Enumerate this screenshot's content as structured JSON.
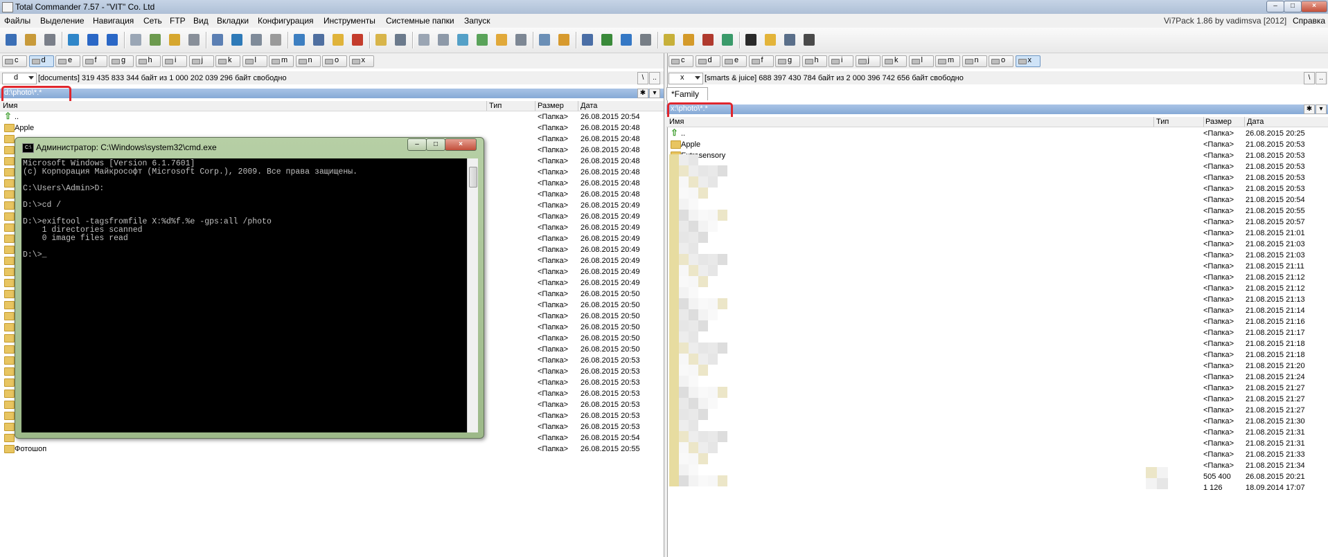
{
  "window": {
    "title": "Total Commander 7.57 - \"VIT\" Co. Ltd",
    "buttons": {
      "minimize": "–",
      "maximize": "□",
      "close": "×"
    }
  },
  "menu": {
    "items": [
      "Файлы",
      "Выделение",
      "Навигация",
      "Сеть",
      "FTP",
      "Вид",
      "Вкладки",
      "Конфигурация",
      "Инструменты",
      "Системные папки",
      "Запуск"
    ],
    "right_info": "Vi7Pack 1.86 by vadimsva  [2012]",
    "help": "Справка"
  },
  "toolbar": {
    "icons": [
      "save-icon",
      "pack-icon",
      "users-icon",
      "refresh-icon",
      "back-icon",
      "forward-icon",
      "copy-icon",
      "new-file-icon",
      "folder-up-icon",
      "tools-icon",
      "list-icon",
      "columns-icon",
      "search-files-icon",
      "clock-icon",
      "network-icon",
      "ftp-icon",
      "folder-icon",
      "delete-icon",
      "view-icon",
      "find-icon",
      "copy-names-icon",
      "grid-icon",
      "eraser-icon",
      "edit-icon",
      "paint-icon",
      "calculator-icon",
      "screen-icon",
      "archive-icon",
      "zoom-icon",
      "windows-icon",
      "monitor-icon",
      "disk-icon",
      "rename-icon",
      "folder-tree-icon",
      "apps-icon",
      "registry-icon",
      "cmd-icon",
      "stopwatch-icon",
      "multi-window-icon",
      "camera-icon"
    ]
  },
  "left": {
    "drives": [
      "c",
      "d",
      "e",
      "f",
      "g",
      "h",
      "i",
      "j",
      "k",
      "l",
      "m",
      "n",
      "o",
      "x"
    ],
    "active_drive": "d",
    "drive_select": "d",
    "info": "[documents]  319 435 833 344 байт из 1 000 202 039 296 байт свободно",
    "path": "d:\\photo\\*.*",
    "headers": {
      "name": "Имя",
      "type": "Тип",
      "size": "Размер",
      "date": "Дата"
    },
    "rows": [
      {
        "name": "..",
        "size": "<Папка>",
        "date": "26.08.2015 20:54"
      },
      {
        "name": "Apple",
        "size": "<Папка>",
        "date": "26.08.2015 20:48"
      },
      {
        "name": "",
        "size": "<Папка>",
        "date": "26.08.2015 20:48"
      },
      {
        "name": "",
        "size": "<Папка>",
        "date": "26.08.2015 20:48"
      },
      {
        "name": "",
        "size": "<Папка>",
        "date": "26.08.2015 20:48"
      },
      {
        "name": "",
        "size": "<Папка>",
        "date": "26.08.2015 20:48"
      },
      {
        "name": "",
        "size": "<Папка>",
        "date": "26.08.2015 20:48"
      },
      {
        "name": "",
        "size": "<Папка>",
        "date": "26.08.2015 20:48"
      },
      {
        "name": "",
        "size": "<Папка>",
        "date": "26.08.2015 20:49"
      },
      {
        "name": "",
        "size": "<Папка>",
        "date": "26.08.2015 20:49"
      },
      {
        "name": "",
        "size": "<Папка>",
        "date": "26.08.2015 20:49"
      },
      {
        "name": "",
        "size": "<Папка>",
        "date": "26.08.2015 20:49"
      },
      {
        "name": "",
        "size": "<Папка>",
        "date": "26.08.2015 20:49"
      },
      {
        "name": "",
        "size": "<Папка>",
        "date": "26.08.2015 20:49"
      },
      {
        "name": "",
        "size": "<Папка>",
        "date": "26.08.2015 20:49"
      },
      {
        "name": "",
        "size": "<Папка>",
        "date": "26.08.2015 20:49"
      },
      {
        "name": "",
        "size": "<Папка>",
        "date": "26.08.2015 20:50"
      },
      {
        "name": "",
        "size": "<Папка>",
        "date": "26.08.2015 20:50"
      },
      {
        "name": "",
        "size": "<Папка>",
        "date": "26.08.2015 20:50"
      },
      {
        "name": "",
        "size": "<Папка>",
        "date": "26.08.2015 20:50"
      },
      {
        "name": "",
        "size": "<Папка>",
        "date": "26.08.2015 20:50"
      },
      {
        "name": "",
        "size": "<Папка>",
        "date": "26.08.2015 20:50"
      },
      {
        "name": "",
        "size": "<Папка>",
        "date": "26.08.2015 20:53"
      },
      {
        "name": "",
        "size": "<Папка>",
        "date": "26.08.2015 20:53"
      },
      {
        "name": "",
        "size": "<Папка>",
        "date": "26.08.2015 20:53"
      },
      {
        "name": "",
        "size": "<Папка>",
        "date": "26.08.2015 20:53"
      },
      {
        "name": "",
        "size": "<Папка>",
        "date": "26.08.2015 20:53"
      },
      {
        "name": "",
        "size": "<Папка>",
        "date": "26.08.2015 20:53"
      },
      {
        "name": "",
        "size": "<Папка>",
        "date": "26.08.2015 20:53"
      },
      {
        "name": "",
        "size": "<Папка>",
        "date": "26.08.2015 20:54"
      },
      {
        "name": "Фотошоп",
        "size": "<Папка>",
        "date": "26.08.2015 20:55"
      }
    ]
  },
  "right": {
    "drives": [
      "c",
      "d",
      "e",
      "f",
      "g",
      "h",
      "i",
      "j",
      "k",
      "l",
      "m",
      "n",
      "o",
      "x"
    ],
    "active_drive": "x",
    "drive_select": "x",
    "info": "[smarts & juice]  688 397 430 784 байт из 2 000 396 742 656 байт свободно",
    "tab": "*Family",
    "path": "x:\\photo\\*.*",
    "headers": {
      "name": "Имя",
      "type": "Тип",
      "size": "Размер",
      "date": "Дата"
    },
    "rows": [
      {
        "name": "..",
        "size": "<Папка>",
        "date": "26.08.2015 20:25"
      },
      {
        "name": "Apple",
        "size": "<Папка>",
        "date": "21.08.2015 20:53"
      },
      {
        "name": "Extrasensory",
        "size": "<Папка>",
        "date": "21.08.2015 20:53"
      },
      {
        "name": "",
        "size": "<Папка>",
        "date": "21.08.2015 20:53"
      },
      {
        "name": "",
        "size": "<Папка>",
        "date": "21.08.2015 20:53"
      },
      {
        "name": "",
        "size": "<Папка>",
        "date": "21.08.2015 20:53"
      },
      {
        "name": "",
        "size": "<Папка>",
        "date": "21.08.2015 20:54"
      },
      {
        "name": "",
        "size": "<Папка>",
        "date": "21.08.2015 20:55"
      },
      {
        "name": "",
        "size": "<Папка>",
        "date": "21.08.2015 20:57"
      },
      {
        "name": "",
        "size": "<Папка>",
        "date": "21.08.2015 21:01"
      },
      {
        "name": "",
        "size": "<Папка>",
        "date": "21.08.2015 21:03"
      },
      {
        "name": "",
        "size": "<Папка>",
        "date": "21.08.2015 21:03"
      },
      {
        "name": "",
        "size": "<Папка>",
        "date": "21.08.2015 21:11"
      },
      {
        "name": "",
        "size": "<Папка>",
        "date": "21.08.2015 21:12"
      },
      {
        "name": "",
        "size": "<Папка>",
        "date": "21.08.2015 21:12"
      },
      {
        "name": "",
        "size": "<Папка>",
        "date": "21.08.2015 21:13"
      },
      {
        "name": "",
        "size": "<Папка>",
        "date": "21.08.2015 21:14"
      },
      {
        "name": "",
        "size": "<Папка>",
        "date": "21.08.2015 21:16"
      },
      {
        "name": "",
        "size": "<Папка>",
        "date": "21.08.2015 21:17"
      },
      {
        "name": "",
        "size": "<Папка>",
        "date": "21.08.2015 21:18"
      },
      {
        "name": "",
        "size": "<Папка>",
        "date": "21.08.2015 21:18"
      },
      {
        "name": "",
        "size": "<Папка>",
        "date": "21.08.2015 21:20"
      },
      {
        "name": "",
        "size": "<Папка>",
        "date": "21.08.2015 21:24"
      },
      {
        "name": "",
        "size": "<Папка>",
        "date": "21.08.2015 21:27"
      },
      {
        "name": "",
        "size": "<Папка>",
        "date": "21.08.2015 21:27"
      },
      {
        "name": "",
        "size": "<Папка>",
        "date": "21.08.2015 21:27"
      },
      {
        "name": "",
        "size": "<Папка>",
        "date": "21.08.2015 21:30"
      },
      {
        "name": "",
        "size": "<Папка>",
        "date": "21.08.2015 21:31"
      },
      {
        "name": "",
        "size": "<Папка>",
        "date": "21.08.2015 21:31"
      },
      {
        "name": "",
        "size": "<Папка>",
        "date": "21.08.2015 21:33"
      },
      {
        "name": "",
        "size": "<Папка>",
        "date": "21.08.2015 21:34"
      },
      {
        "name": "",
        "size": "505 400",
        "date": "26.08.2015 20:21"
      },
      {
        "name": "",
        "size": "1 126",
        "date": "18.09.2014 17:07"
      }
    ]
  },
  "cmd": {
    "title": "Администратор: C:\\Windows\\system32\\cmd.exe",
    "icon_text": "C:\\",
    "lines": [
      "Microsoft Windows [Version 6.1.7601]",
      "(c) Корпорация Майкрософт (Microsoft Corp.), 2009. Все права защищены.",
      "",
      "C:\\Users\\Admin>D:",
      "",
      "D:\\>cd /",
      "",
      "D:\\>exiftool -tagsfromfile X:%d%f.%e -gps:all /photo",
      "    1 directories scanned",
      "    0 image files read",
      "",
      "D:\\>_"
    ]
  }
}
